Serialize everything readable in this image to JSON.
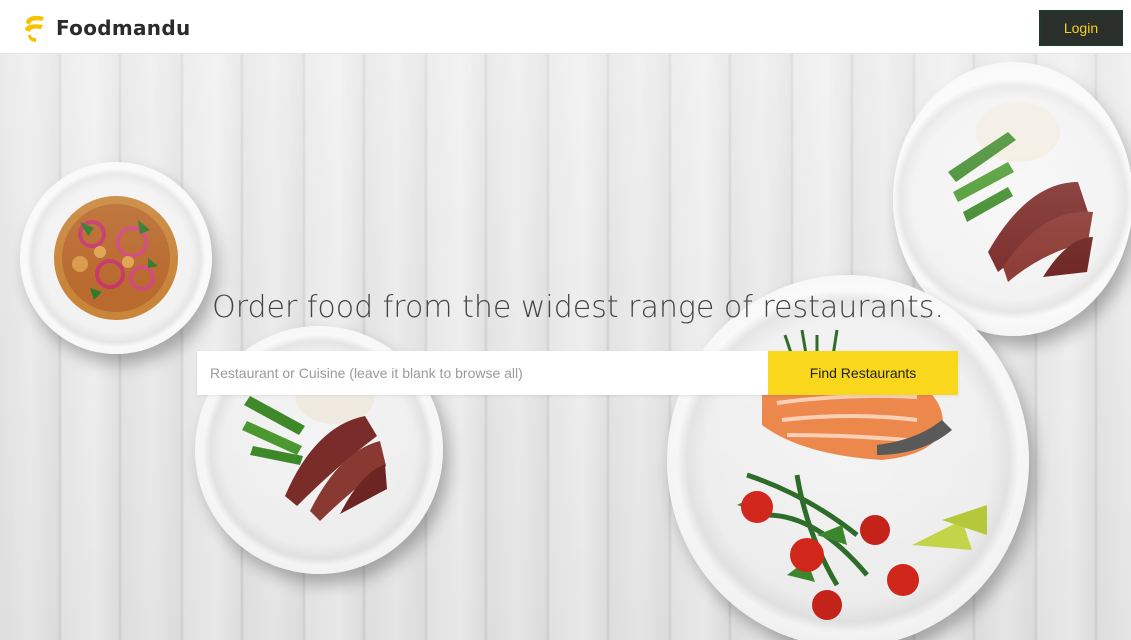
{
  "header": {
    "brand_name": "Foodmandu",
    "login_label": "Login"
  },
  "hero": {
    "headline": "Order food from the widest range of restaurants.",
    "search": {
      "placeholder": "Restaurant or Cuisine (leave it blank to browse all)",
      "value": "",
      "button_label": "Find Restaurants"
    }
  },
  "colors": {
    "accent_yellow": "#f9d71c",
    "login_bg": "#2b2f2b",
    "login_text": "#f7d21c"
  },
  "icons": {
    "logo": "foodmandu-logo-icon"
  }
}
